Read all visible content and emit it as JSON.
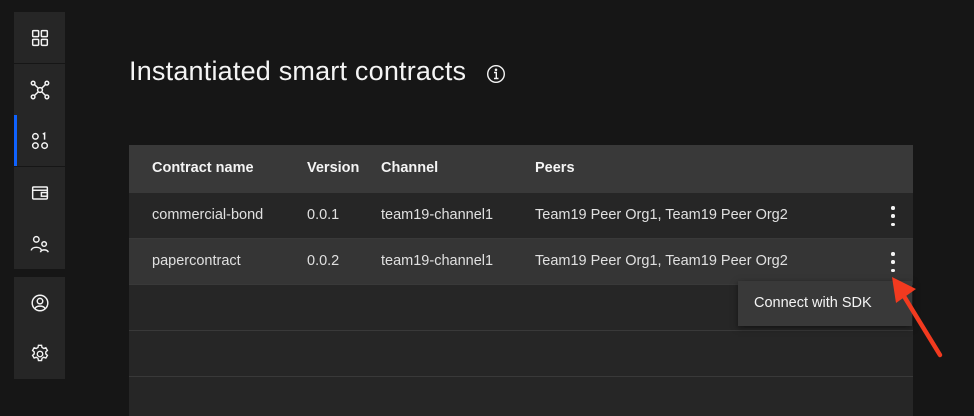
{
  "page": {
    "title": "Instantiated smart contracts",
    "info_icon": "information-icon"
  },
  "sidebar": {
    "items": [
      {
        "icon": "grid-icon",
        "active": false
      },
      {
        "icon": "network-icon",
        "active": false
      },
      {
        "icon": "smart-contracts-icon",
        "active": true
      },
      {
        "icon": "wallet-icon",
        "active": false
      },
      {
        "icon": "users-icon",
        "active": false
      },
      {
        "icon": "user-profile-icon",
        "active": false
      },
      {
        "icon": "settings-icon",
        "active": false
      }
    ],
    "active_color": "#0f62fe"
  },
  "table": {
    "headers": [
      "Contract name",
      "Version",
      "Channel",
      "Peers"
    ],
    "rows": [
      {
        "name": "commercial-bond",
        "version": "0.0.1",
        "channel": "team19-channel1",
        "peers": "Team19 Peer Org1, Team19 Peer Org2"
      },
      {
        "name": "papercontract",
        "version": "0.0.2",
        "channel": "team19-channel1",
        "peers": "Team19 Peer Org1, Team19 Peer Org2"
      }
    ]
  },
  "overflow_menu": {
    "items": [
      "Connect with SDK"
    ]
  },
  "annotation": {
    "color": "#f23a1f"
  }
}
